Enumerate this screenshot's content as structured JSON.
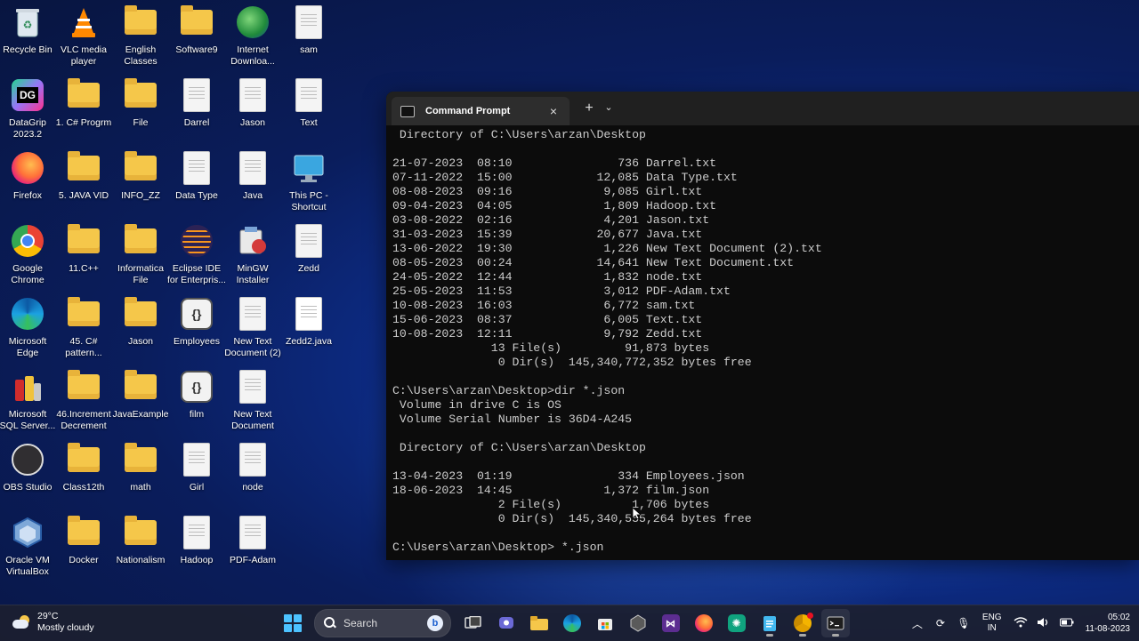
{
  "desktop": {
    "icons": [
      {
        "label": "Recycle Bin",
        "icon": "recycle-bin-icon"
      },
      {
        "label": "VLC media\nplayer",
        "icon": "vlc-icon"
      },
      {
        "label": "English\nClasses",
        "icon": "folder-icon"
      },
      {
        "label": "Software9",
        "icon": "folder-icon"
      },
      {
        "label": "Internet\nDownloa...",
        "icon": "internet-download-manager-icon"
      },
      {
        "label": "sam",
        "icon": "text-file-icon"
      },
      {
        "label": "DataGrip\n2023.2",
        "icon": "datagrip-icon"
      },
      {
        "label": "1. C# Progrm",
        "icon": "folder-icon"
      },
      {
        "label": "File",
        "icon": "folder-icon"
      },
      {
        "label": "Darrel",
        "icon": "text-file-icon"
      },
      {
        "label": "Jason",
        "icon": "text-file-icon"
      },
      {
        "label": "Text",
        "icon": "text-file-icon"
      },
      {
        "label": "Firefox",
        "icon": "firefox-icon"
      },
      {
        "label": "5. JAVA VID",
        "icon": "folder-icon"
      },
      {
        "label": "INFO_ZZ",
        "icon": "folder-icon"
      },
      {
        "label": "Data Type",
        "icon": "text-file-icon"
      },
      {
        "label": "Java",
        "icon": "text-file-icon"
      },
      {
        "label": "This PC -\nShortcut",
        "icon": "this-pc-icon"
      },
      {
        "label": "Google\nChrome",
        "icon": "chrome-icon"
      },
      {
        "label": "11.C++",
        "icon": "folder-icon"
      },
      {
        "label": "Informatica\nFile",
        "icon": "folder-icon"
      },
      {
        "label": "Eclipse IDE\nfor Enterpris...",
        "icon": "eclipse-icon"
      },
      {
        "label": "MinGW\nInstaller",
        "icon": "mingw-installer-icon"
      },
      {
        "label": "Zedd",
        "icon": "text-file-icon"
      },
      {
        "label": "Microsoft\nEdge",
        "icon": "edge-icon"
      },
      {
        "label": "45. C#\npattern...",
        "icon": "folder-icon"
      },
      {
        "label": "Jason",
        "icon": "folder-icon"
      },
      {
        "label": "Employees",
        "icon": "json-file-icon"
      },
      {
        "label": "New Text\nDocument (2)",
        "icon": "text-file-icon"
      },
      {
        "label": "Zedd2.java",
        "icon": "java-file-icon"
      },
      {
        "label": "Microsoft\nSQL Server...",
        "icon": "sql-server-icon"
      },
      {
        "label": "46.Increment\nDecrement",
        "icon": "folder-icon"
      },
      {
        "label": "JavaExample",
        "icon": "folder-icon"
      },
      {
        "label": "film",
        "icon": "json-file-icon"
      },
      {
        "label": "New Text\nDocument",
        "icon": "text-file-icon"
      },
      {
        "label": "OBS Studio",
        "icon": "obs-icon"
      },
      {
        "label": "Class12th",
        "icon": "folder-icon"
      },
      {
        "label": "math",
        "icon": "folder-icon"
      },
      {
        "label": "Girl",
        "icon": "text-file-icon"
      },
      {
        "label": "node",
        "icon": "text-file-icon"
      },
      {
        "label": "Oracle VM\nVirtualBox",
        "icon": "virtualbox-icon"
      },
      {
        "label": "Docker",
        "icon": "folder-icon"
      },
      {
        "label": "Nationalism",
        "icon": "folder-icon"
      },
      {
        "label": "Hadoop",
        "icon": "text-file-icon"
      },
      {
        "label": "PDF-Adam",
        "icon": "text-file-icon"
      }
    ]
  },
  "terminal": {
    "tab_title": "Command Prompt",
    "close_symbol": "×",
    "new_tab_symbol": "+",
    "dropdown_symbol": "⌄",
    "lines": [
      " Directory of C:\\Users\\arzan\\Desktop",
      "",
      "21-07-2023  08:10               736 Darrel.txt",
      "07-11-2022  15:00            12,085 Data Type.txt",
      "08-08-2023  09:16             9,085 Girl.txt",
      "09-04-2023  04:05             1,809 Hadoop.txt",
      "03-08-2022  02:16             4,201 Jason.txt",
      "31-03-2023  15:39            20,677 Java.txt",
      "13-06-2022  19:30             1,226 New Text Document (2).txt",
      "08-05-2023  00:24            14,641 New Text Document.txt",
      "24-05-2022  12:44             1,832 node.txt",
      "25-05-2023  11:53             3,012 PDF-Adam.txt",
      "10-08-2023  16:03             6,772 sam.txt",
      "15-06-2023  08:37             6,005 Text.txt",
      "10-08-2023  12:11             9,792 Zedd.txt",
      "              13 File(s)         91,873 bytes",
      "               0 Dir(s)  145,340,772,352 bytes free",
      "",
      "C:\\Users\\arzan\\Desktop>dir *.json",
      " Volume in drive C is OS",
      " Volume Serial Number is 36D4-A245",
      "",
      " Directory of C:\\Users\\arzan\\Desktop",
      "",
      "13-04-2023  01:19               334 Employees.json",
      "18-06-2023  14:45             1,372 film.json",
      "               2 File(s)          1,706 bytes",
      "               0 Dir(s)  145,340,555,264 bytes free",
      "",
      "C:\\Users\\arzan\\Desktop> *.json"
    ]
  },
  "taskbar": {
    "weather_temp": "29°C",
    "weather_desc": "Mostly cloudy",
    "search_placeholder": "Search",
    "bing_label": "b",
    "language_line1": "ENG",
    "language_line2": "IN",
    "time": "05:02",
    "date": "11-08-2023",
    "apps": [
      "start-button",
      "search",
      "copilot-icon",
      "task-view-icon",
      "teams-chat-icon",
      "file-explorer-icon",
      "edge-icon",
      "store-icon",
      "unity-icon",
      "visual-studio-icon",
      "firefox-icon",
      "chatgpt-icon",
      "notepad-icon",
      "chrome-canary-icon",
      "terminal-icon"
    ]
  },
  "colors": {
    "accent": "#4cc2ff",
    "terminal_bg": "#0c0c0c",
    "terminal_text": "#cccccc",
    "folder": "#f5c74a"
  }
}
